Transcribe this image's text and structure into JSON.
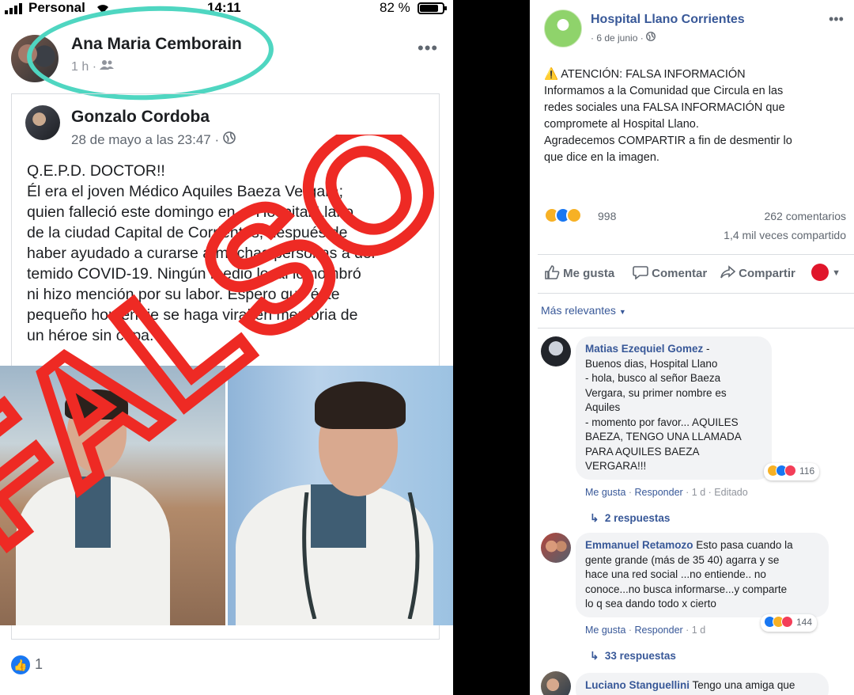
{
  "status_bar": {
    "carrier": "Personal",
    "time": "14:11",
    "battery": "82 %",
    "battery_level": 0.82
  },
  "left_post": {
    "author": "Ana Maria Cemborain",
    "meta": "1 h ·",
    "shared": {
      "author": "Gonzalo Cordoba",
      "meta": "28 de mayo a las 23:47 ·",
      "text_lines": [
        "Q.E.P.D. DOCTOR!!",
        "Él era el joven Médico Aquiles Baeza Vergara;",
        "quien falleció este domingo en el Hospital Llano",
        "de la ciudad Capital de Corrientes, después de",
        "haber ayudado a curarse a muchas personas a del",
        "temido COVID-19. Ningún medio local lo nombró",
        "ni hizo mención por su labor. Espero que éste",
        "pequeño homenaje se haga viral en memoria de",
        "un héroe sin capa."
      ]
    },
    "overlay_word": "FALSO",
    "likes": "1"
  },
  "right_post": {
    "page_name": "Hospital Llano Corrientes",
    "meta": "· 6 de junio ·",
    "text_lines": [
      "⚠️ ATENCIÓN: FALSA INFORMACIÓN",
      "Informamos a la Comunidad que Circula en las",
      "redes sociales una FALSA INFORMACIÓN que",
      "compromete al Hospital Llano.",
      "Agradecemos COMPARTIR a fin de desmentir lo",
      "que dice en la imagen."
    ],
    "reactions_count": "998",
    "comments_count": "262 comentarios",
    "shares_count": "1,4 mil veces compartido",
    "actions": {
      "like": "Me gusta",
      "comment": "Comentar",
      "share": "Compartir"
    },
    "sort_label": "Más relevantes",
    "comments": [
      {
        "author": "Matias Ezequiel Gomez",
        "lines": [
          " - ",
          "Buenos dias, Hospital Llano",
          "- hola, busco al señor Baeza",
          "Vergara, su primer nombre es",
          "Aquiles",
          "- momento por favor... AQUILES",
          "BAEZA, TENGO UNA LLAMADA",
          "PARA AQUILES BAEZA",
          "VERGARA!!!"
        ],
        "reactions": "116",
        "like": "Me gusta",
        "reply": "Responder",
        "time": "1 d",
        "edited": "Editado",
        "replies": "2 respuestas"
      },
      {
        "author": "Emmanuel Retamozo",
        "lines": [
          " Esto pasa cuando la",
          "gente grande (más de 35 40) agarra y se",
          "hace una red social ...no entiende.. no",
          "conoce...no busca informarse...y comparte",
          "lo q sea dando todo x cierto"
        ],
        "reactions": "144",
        "like": "Me gusta",
        "reply": "Responder",
        "time": "1 d",
        "replies": "33 respuestas"
      },
      {
        "author": "Luciano Stanguellini",
        "lines": [
          " Tengo una amiga que"
        ]
      }
    ]
  }
}
